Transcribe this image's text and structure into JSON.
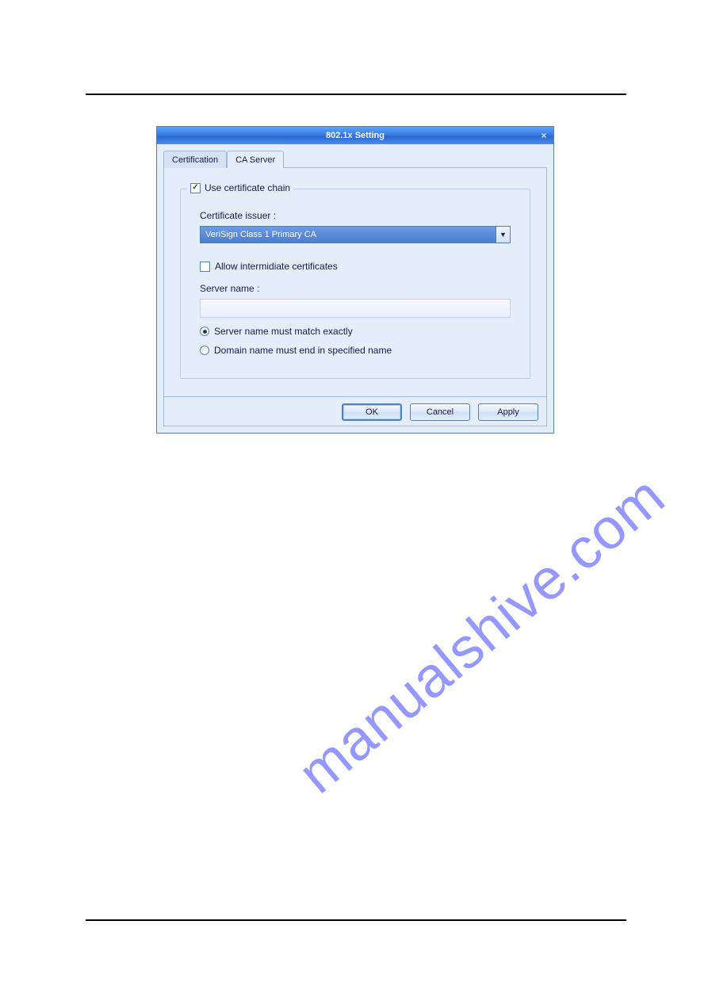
{
  "watermark": "manualshive.com",
  "dialog": {
    "title": "802.1x Setting",
    "close_icon": "×",
    "tabs": {
      "certification": "Certification",
      "ca_server": "CA Server"
    },
    "group": {
      "use_chain_label": "Use certificate chain",
      "use_chain_checked": true,
      "issuer_label": "Certificate issuer :",
      "issuer_value": "VeriSign Class 1 Primary CA",
      "allow_intermediate_label": "Allow intermidiate certificates",
      "allow_intermediate_checked": false,
      "server_name_label": "Server name :",
      "server_name_value": "",
      "radio_match_exact": "Server name must match exactly",
      "radio_domain_end": "Domain name must end in specified name",
      "radio_selected": "exact"
    },
    "buttons": {
      "ok": "OK",
      "cancel": "Cancel",
      "apply": "Apply"
    }
  }
}
